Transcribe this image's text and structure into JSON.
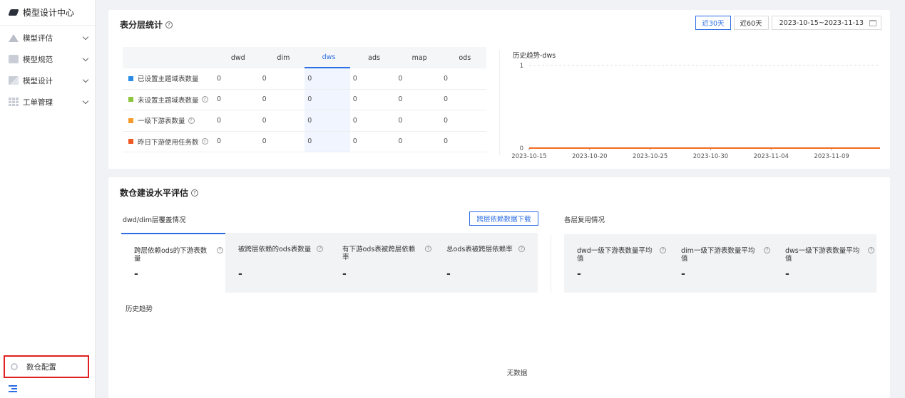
{
  "sidebar": {
    "title": "模型设计中心",
    "items": [
      {
        "label": "模型评估",
        "icon": "warning-triangle-icon"
      },
      {
        "label": "模型规范",
        "icon": "book-icon"
      },
      {
        "label": "模型设计",
        "icon": "design-icon"
      },
      {
        "label": "工单管理",
        "icon": "grid-icon"
      }
    ],
    "config_label": "数仓配置"
  },
  "layer_stats": {
    "title": "表分层统计",
    "range_buttons": [
      "近30天",
      "近60天"
    ],
    "active_range": "近30天",
    "date_range": "2023-10-15~2023-11-13",
    "columns": [
      "dwd",
      "dim",
      "dws",
      "ads",
      "map",
      "ods"
    ],
    "selected_column": "dws",
    "rows": [
      {
        "label": "已设置主题域表数量",
        "color": "#2b8be5",
        "help": false,
        "values": [
          "0",
          "0",
          "0",
          "0",
          "0",
          "0"
        ]
      },
      {
        "label": "未设置主题域表数量",
        "color": "#8cc63f",
        "help": true,
        "values": [
          "0",
          "0",
          "0",
          "0",
          "0",
          "0"
        ]
      },
      {
        "label": "一级下游表数量",
        "color": "#f59b2e",
        "help": true,
        "values": [
          "0",
          "0",
          "0",
          "0",
          "0",
          "0"
        ]
      },
      {
        "label": "昨日下游使用任务数",
        "color": "#ee5a24",
        "help": true,
        "values": [
          "0",
          "0",
          "0",
          "0",
          "0",
          "0"
        ]
      }
    ]
  },
  "chart_data": {
    "type": "line",
    "title": "历史趋势-dws",
    "x_ticks": [
      "2023-10-15",
      "2023-10-20",
      "2023-10-25",
      "2023-10-30",
      "2023-11-04",
      "2023-11-09"
    ],
    "y_ticks": [
      "0",
      "1"
    ],
    "ylim": [
      0,
      1
    ],
    "series": [
      {
        "values": [
          0,
          0
        ],
        "color": "#f26a21"
      }
    ],
    "x": [
      "2023-10-15",
      "2023-11-13"
    ]
  },
  "warehouse_eval": {
    "title": "数仓建设水平评估",
    "left_title": "dwd/dim层覆盖情况",
    "download_label": "跨层依赖数据下载",
    "right_title": "各层复用情况",
    "left_metrics": [
      {
        "label": "跨层依赖ods的下游表数量",
        "value": "-"
      },
      {
        "label": "被跨层依赖的ods表数量",
        "value": "-"
      },
      {
        "label": "有下游ods表被跨层依赖率",
        "value": "-"
      },
      {
        "label": "总ods表被跨层依赖率",
        "value": "-"
      }
    ],
    "right_metrics": [
      {
        "label": "dwd一级下游表数量平均值",
        "value": "-"
      },
      {
        "label": "dim一级下游表数量平均值",
        "value": "-"
      },
      {
        "label": "dws一级下游表数量平均值",
        "value": "-"
      }
    ],
    "history_label": "历史趋势",
    "no_data": "无数据"
  }
}
